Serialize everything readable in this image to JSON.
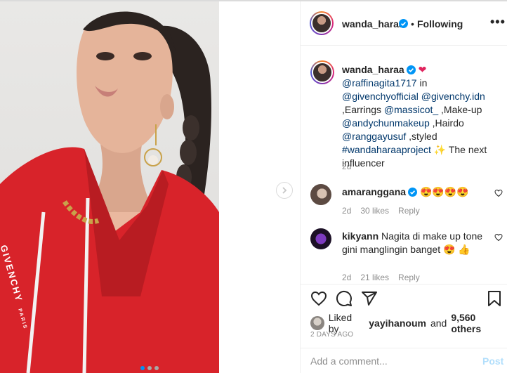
{
  "post": {
    "username": "wanda_haraa",
    "follow_status": "Following",
    "bullet": "•",
    "more": "•••",
    "caption": {
      "heart": "❤",
      "mention_raffi": "@raffinagita1717",
      "in": "in",
      "mention_givenchy": "@givenchyofficial",
      "mention_givenchy_idn": "@givenchy.idn",
      "earrings": ",Earrings",
      "mention_massicot": "@massicot_",
      "makeup": ",Make-up",
      "mention_andy": "@andychunmakeup",
      "hairdo": ",Hairdo",
      "mention_rangga": "@ranggayusuf",
      "styled": ",styled",
      "hashtag": "#wandaharaaproject",
      "sparkle": "✨",
      "tail": "The next influencer",
      "age": "2d"
    },
    "comments": [
      {
        "username": "amaranggana",
        "text": "😍😍😍😍",
        "age": "2d",
        "likes": "30 likes",
        "reply": "Reply",
        "verified": true
      },
      {
        "username": "kikyann",
        "text": "Nagita di make up tone gini manglingin banget 😍 👍",
        "age": "2d",
        "likes": "21 likes",
        "reply": "Reply",
        "verified": false
      }
    ],
    "liked_by": {
      "prefix": "Liked by",
      "user": "yayihanoum",
      "and": "and",
      "others": "9,560 others"
    },
    "date": "2 DAYS AGO",
    "add_comment_placeholder": "Add a comment...",
    "post_label": "Post",
    "carousel": {
      "count": 3,
      "active": 0
    }
  },
  "image": {
    "brand_text": "GIVENCHY",
    "brand_sub": "PARIS"
  },
  "colors": {
    "accent": "#0095f6",
    "link": "#00376b",
    "muted": "#8e8e8e",
    "post_disabled": "#b2dffc",
    "dress": "#d8232a"
  },
  "icons": [
    "verified-badge-icon",
    "heart-icon",
    "comment-icon",
    "share-icon",
    "bookmark-icon",
    "chevron-right-icon",
    "more-options-icon"
  ]
}
